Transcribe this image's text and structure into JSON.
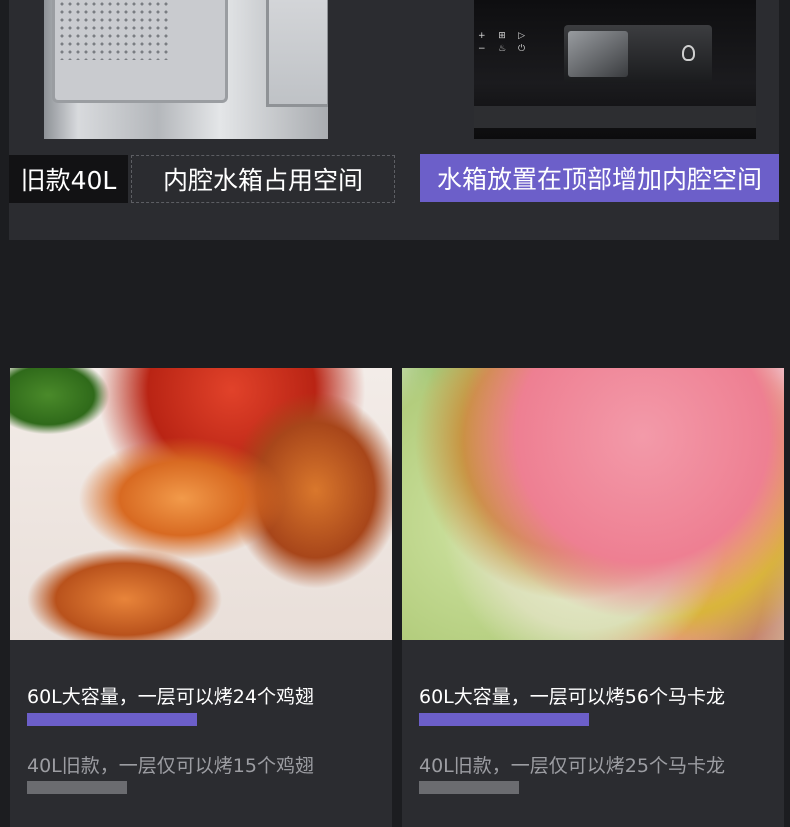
{
  "comparison": {
    "old_tag": "旧款40L",
    "old_desc": "内腔水箱占用空间",
    "new_desc": "水箱放置在顶部增加内腔空间",
    "panel_labels": {
      "plus": "+",
      "minus": "−",
      "play": "▷",
      "power": "⏻",
      "grid": "⊞",
      "tap": "♨"
    }
  },
  "cards": [
    {
      "image": "roast-chicken-wings",
      "capacity_new": "60L大容量，一层可以烤24个鸡翅",
      "capacity_old": "40L旧款，一层仅可以烤15个鸡翅",
      "count_new": 24,
      "count_old": 15
    },
    {
      "image": "macarons",
      "capacity_new": "60L大容量，一层可以烤56个马卡龙",
      "capacity_old": "40L旧款，一层仅可以烤25个马卡龙",
      "count_new": 56,
      "count_old": 25
    }
  ],
  "colors": {
    "accent": "#6c5fc9",
    "background": "#1c1d20",
    "panel": "#2b2c30",
    "muted_bar": "#6b6c70"
  }
}
